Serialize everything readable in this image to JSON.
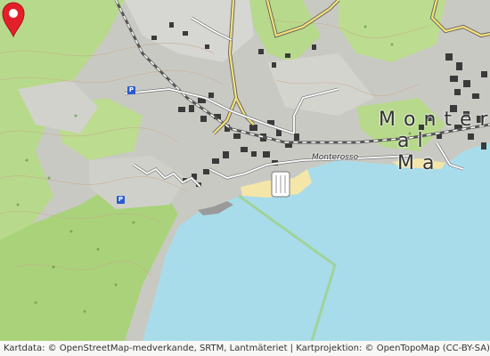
{
  "map": {
    "place_label_line1": "Montero",
    "place_label_line2": "al Ma",
    "street_label": "Monterosso",
    "parking_symbol": "P",
    "marker_icon": "map-pin-icon",
    "attribution": "Kartdata: © OpenStreetMap-medverkande, SRTM, Lantmäteriet | Kartprojektion: © OpenTopoMap (CC-BY-SA)",
    "colors": {
      "sea": "#a8dceb",
      "forest": "#b7d98b",
      "rock": "#bdbdbd",
      "beach": "#f4e6a8",
      "road_major": "#f2df7a",
      "marker": "#e3202a",
      "parking": "#2a5ccf",
      "boundary": "#9fd39a"
    }
  }
}
